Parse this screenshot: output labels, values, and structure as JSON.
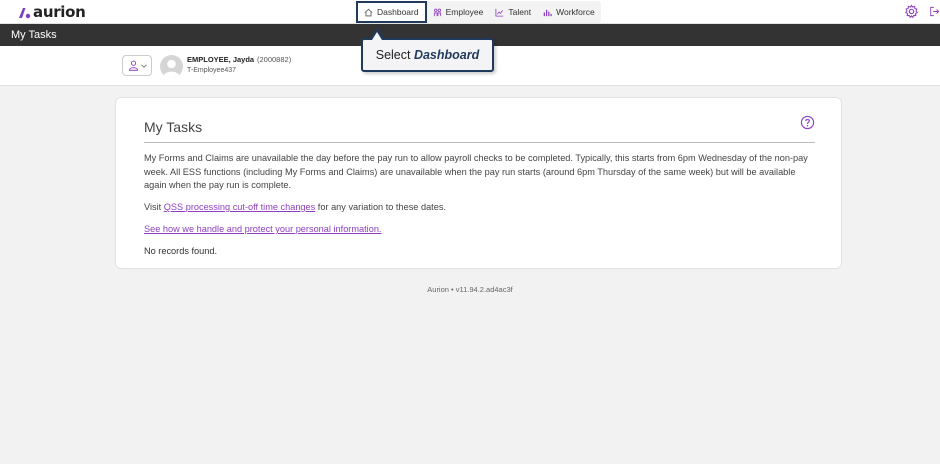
{
  "app": {
    "logo_text": "aurion"
  },
  "nav": {
    "items": [
      {
        "label": "Dashboard",
        "icon": "home-icon",
        "active": true
      },
      {
        "label": "Employee",
        "icon": "people-icon",
        "active": false
      },
      {
        "label": "Talent",
        "icon": "line-chart-icon",
        "active": false
      },
      {
        "label": "Workforce",
        "icon": "bar-chart-icon",
        "active": false
      }
    ]
  },
  "header": {
    "title": "My Tasks"
  },
  "user": {
    "name": "EMPLOYEE, Jayda",
    "id": "(2000882)",
    "code": "T-Employee437"
  },
  "tooltip": {
    "prefix": "Select ",
    "target": "Dashboard"
  },
  "card": {
    "title": "My Tasks",
    "paragraph1": "My Forms and Claims are unavailable the day before the pay run to allow payroll checks to be completed. Typically, this starts from 6pm Wednesday of the non-pay week. All ESS functions (including My Forms and Claims) are unavailable when the pay run starts (around 6pm Thursday of the same week) but will be available again when the pay run is complete.",
    "visit_prefix": "Visit ",
    "visit_link": "QSS processing cut-off time changes",
    "visit_suffix": " for any variation to these dates.",
    "privacy_link": "See how we handle and protect your personal information.",
    "empty_state": "No records found."
  },
  "footer": {
    "version": "Aurion • v11.94.2.ad4ac3f"
  },
  "colors": {
    "accent": "#8c3fbf",
    "header_bg": "#333333",
    "highlight": "#1f3a5c"
  }
}
